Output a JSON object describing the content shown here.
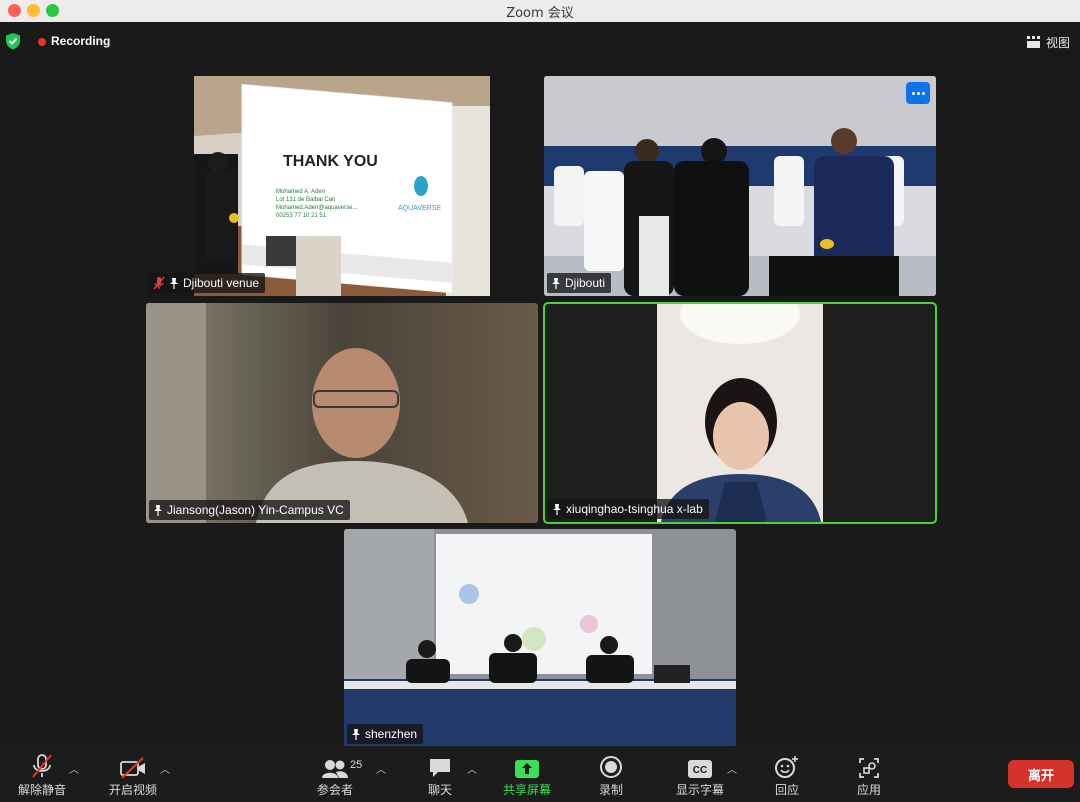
{
  "window": {
    "title": "Zoom 会议"
  },
  "status": {
    "recording_label": "Recording",
    "view_label": "视图"
  },
  "participants": [
    {
      "name": "Djibouti venue",
      "muted": true
    },
    {
      "name": "Djibouti"
    },
    {
      "name": "Jiansong(Jason) Yin-Campus VC"
    },
    {
      "name": "xiuqinghao-tsinghua x-lab",
      "active_speaker": true
    },
    {
      "name": "shenzhen"
    }
  ],
  "slide": {
    "heading": "THANK YOU",
    "lines": [
      "Mohamed A. Aden",
      "Lot 131 de Balbal Can",
      "Mohamed.Aden@aquaverse...",
      "00253 77 10 21 51"
    ],
    "brand": "AQUAVERSE"
  },
  "toolbar": {
    "mute_label": "解除静音",
    "video_label": "开启视频",
    "participants_label": "参会者",
    "participants_count": "25",
    "chat_label": "聊天",
    "share_label": "共享屏幕",
    "record_label": "录制",
    "captions_label": "显示字幕",
    "captions_badge": "CC",
    "reactions_label": "回应",
    "apps_label": "应用",
    "leave_label": "离开"
  },
  "colors": {
    "active_border": "#4cd137",
    "leave": "#d5322c",
    "share": "#3ddc5a",
    "more": "#0e72ed",
    "recording_dot": "#e5342a"
  }
}
